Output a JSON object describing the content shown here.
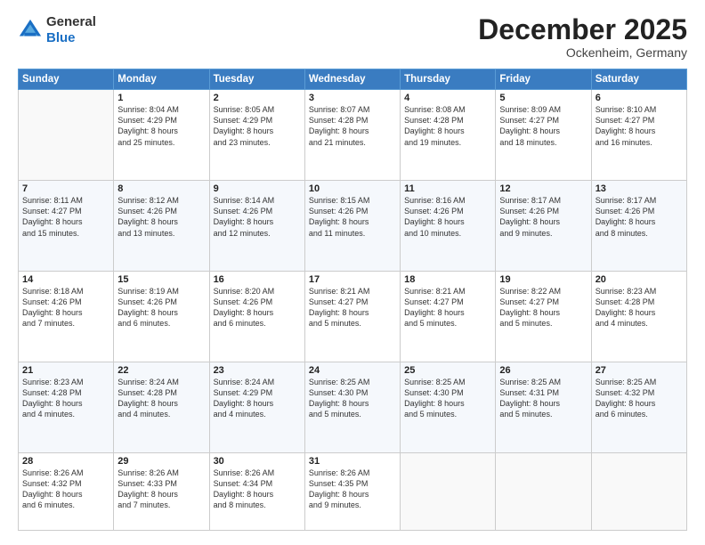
{
  "header": {
    "logo": {
      "line1": "General",
      "line2": "Blue"
    },
    "title": "December 2025",
    "location": "Ockenheim, Germany"
  },
  "weekdays": [
    "Sunday",
    "Monday",
    "Tuesday",
    "Wednesday",
    "Thursday",
    "Friday",
    "Saturday"
  ],
  "weeks": [
    [
      {
        "day": "",
        "info": ""
      },
      {
        "day": "1",
        "info": "Sunrise: 8:04 AM\nSunset: 4:29 PM\nDaylight: 8 hours\nand 25 minutes."
      },
      {
        "day": "2",
        "info": "Sunrise: 8:05 AM\nSunset: 4:29 PM\nDaylight: 8 hours\nand 23 minutes."
      },
      {
        "day": "3",
        "info": "Sunrise: 8:07 AM\nSunset: 4:28 PM\nDaylight: 8 hours\nand 21 minutes."
      },
      {
        "day": "4",
        "info": "Sunrise: 8:08 AM\nSunset: 4:28 PM\nDaylight: 8 hours\nand 19 minutes."
      },
      {
        "day": "5",
        "info": "Sunrise: 8:09 AM\nSunset: 4:27 PM\nDaylight: 8 hours\nand 18 minutes."
      },
      {
        "day": "6",
        "info": "Sunrise: 8:10 AM\nSunset: 4:27 PM\nDaylight: 8 hours\nand 16 minutes."
      }
    ],
    [
      {
        "day": "7",
        "info": "Sunrise: 8:11 AM\nSunset: 4:27 PM\nDaylight: 8 hours\nand 15 minutes."
      },
      {
        "day": "8",
        "info": "Sunrise: 8:12 AM\nSunset: 4:26 PM\nDaylight: 8 hours\nand 13 minutes."
      },
      {
        "day": "9",
        "info": "Sunrise: 8:14 AM\nSunset: 4:26 PM\nDaylight: 8 hours\nand 12 minutes."
      },
      {
        "day": "10",
        "info": "Sunrise: 8:15 AM\nSunset: 4:26 PM\nDaylight: 8 hours\nand 11 minutes."
      },
      {
        "day": "11",
        "info": "Sunrise: 8:16 AM\nSunset: 4:26 PM\nDaylight: 8 hours\nand 10 minutes."
      },
      {
        "day": "12",
        "info": "Sunrise: 8:17 AM\nSunset: 4:26 PM\nDaylight: 8 hours\nand 9 minutes."
      },
      {
        "day": "13",
        "info": "Sunrise: 8:17 AM\nSunset: 4:26 PM\nDaylight: 8 hours\nand 8 minutes."
      }
    ],
    [
      {
        "day": "14",
        "info": "Sunrise: 8:18 AM\nSunset: 4:26 PM\nDaylight: 8 hours\nand 7 minutes."
      },
      {
        "day": "15",
        "info": "Sunrise: 8:19 AM\nSunset: 4:26 PM\nDaylight: 8 hours\nand 6 minutes."
      },
      {
        "day": "16",
        "info": "Sunrise: 8:20 AM\nSunset: 4:26 PM\nDaylight: 8 hours\nand 6 minutes."
      },
      {
        "day": "17",
        "info": "Sunrise: 8:21 AM\nSunset: 4:27 PM\nDaylight: 8 hours\nand 5 minutes."
      },
      {
        "day": "18",
        "info": "Sunrise: 8:21 AM\nSunset: 4:27 PM\nDaylight: 8 hours\nand 5 minutes."
      },
      {
        "day": "19",
        "info": "Sunrise: 8:22 AM\nSunset: 4:27 PM\nDaylight: 8 hours\nand 5 minutes."
      },
      {
        "day": "20",
        "info": "Sunrise: 8:23 AM\nSunset: 4:28 PM\nDaylight: 8 hours\nand 4 minutes."
      }
    ],
    [
      {
        "day": "21",
        "info": "Sunrise: 8:23 AM\nSunset: 4:28 PM\nDaylight: 8 hours\nand 4 minutes."
      },
      {
        "day": "22",
        "info": "Sunrise: 8:24 AM\nSunset: 4:28 PM\nDaylight: 8 hours\nand 4 minutes."
      },
      {
        "day": "23",
        "info": "Sunrise: 8:24 AM\nSunset: 4:29 PM\nDaylight: 8 hours\nand 4 minutes."
      },
      {
        "day": "24",
        "info": "Sunrise: 8:25 AM\nSunset: 4:30 PM\nDaylight: 8 hours\nand 5 minutes."
      },
      {
        "day": "25",
        "info": "Sunrise: 8:25 AM\nSunset: 4:30 PM\nDaylight: 8 hours\nand 5 minutes."
      },
      {
        "day": "26",
        "info": "Sunrise: 8:25 AM\nSunset: 4:31 PM\nDaylight: 8 hours\nand 5 minutes."
      },
      {
        "day": "27",
        "info": "Sunrise: 8:25 AM\nSunset: 4:32 PM\nDaylight: 8 hours\nand 6 minutes."
      }
    ],
    [
      {
        "day": "28",
        "info": "Sunrise: 8:26 AM\nSunset: 4:32 PM\nDaylight: 8 hours\nand 6 minutes."
      },
      {
        "day": "29",
        "info": "Sunrise: 8:26 AM\nSunset: 4:33 PM\nDaylight: 8 hours\nand 7 minutes."
      },
      {
        "day": "30",
        "info": "Sunrise: 8:26 AM\nSunset: 4:34 PM\nDaylight: 8 hours\nand 8 minutes."
      },
      {
        "day": "31",
        "info": "Sunrise: 8:26 AM\nSunset: 4:35 PM\nDaylight: 8 hours\nand 9 minutes."
      },
      {
        "day": "",
        "info": ""
      },
      {
        "day": "",
        "info": ""
      },
      {
        "day": "",
        "info": ""
      }
    ]
  ]
}
